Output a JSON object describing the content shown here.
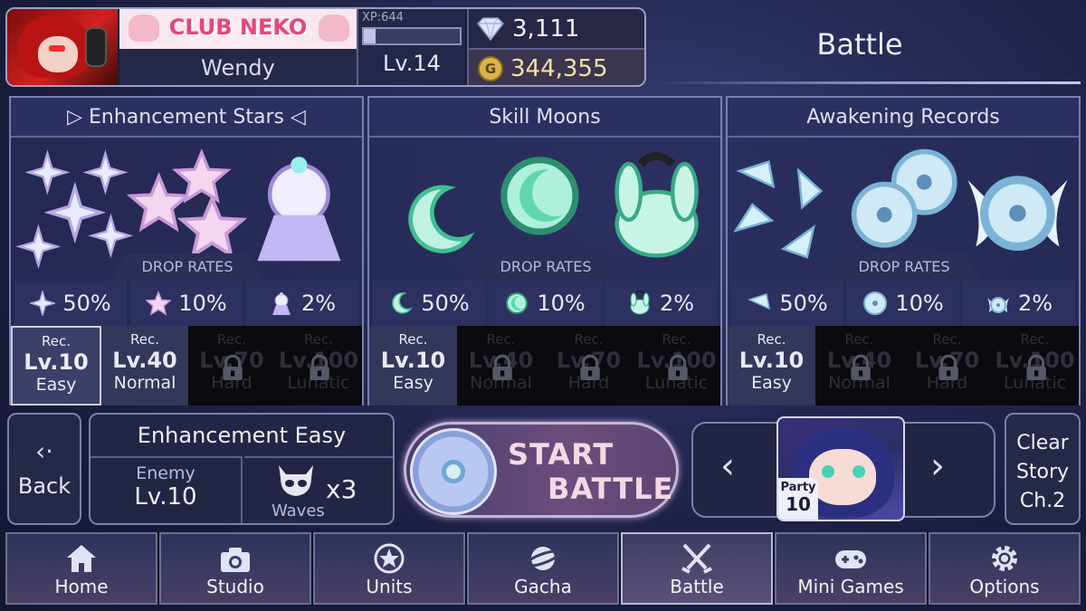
{
  "header": {
    "club_name": "CLUB NEKO",
    "username": "Wendy",
    "xp_label": "XP:644",
    "xp_fraction": 0.12,
    "level": "Lv.14",
    "gems": "3,111",
    "gold_icon": "G",
    "gold": "344,355",
    "screen_title": "Battle"
  },
  "panels": [
    {
      "title": "▷ Enhancement Stars ◁",
      "drop_label": "DROP RATES",
      "rates": [
        "50%",
        "10%",
        "2%"
      ],
      "difficulties": [
        {
          "rec": "Rec.",
          "level": "Lv.10",
          "name": "Easy",
          "state": "selected"
        },
        {
          "rec": "Rec.",
          "level": "Lv.40",
          "name": "Normal",
          "state": "open"
        },
        {
          "rec": "Rec.",
          "level": "Lv.70",
          "name": "Hard",
          "state": "locked"
        },
        {
          "rec": "Rec.",
          "level": "Lv.100",
          "name": "Lunatic",
          "state": "locked"
        }
      ]
    },
    {
      "title": "Skill Moons",
      "drop_label": "DROP RATES",
      "rates": [
        "50%",
        "10%",
        "2%"
      ],
      "difficulties": [
        {
          "rec": "Rec.",
          "level": "Lv.10",
          "name": "Easy",
          "state": "open"
        },
        {
          "rec": "Rec.",
          "level": "Lv.40",
          "name": "Normal",
          "state": "locked"
        },
        {
          "rec": "Rec.",
          "level": "Lv.70",
          "name": "Hard",
          "state": "locked"
        },
        {
          "rec": "Rec.",
          "level": "Lv.100",
          "name": "Lunatic",
          "state": "locked"
        }
      ]
    },
    {
      "title": "Awakening Records",
      "drop_label": "DROP RATES",
      "rates": [
        "50%",
        "10%",
        "2%"
      ],
      "difficulties": [
        {
          "rec": "Rec.",
          "level": "Lv.10",
          "name": "Easy",
          "state": "open"
        },
        {
          "rec": "Rec.",
          "level": "Lv.40",
          "name": "Normal",
          "state": "locked"
        },
        {
          "rec": "Rec.",
          "level": "Lv.70",
          "name": "Hard",
          "state": "locked"
        },
        {
          "rec": "Rec.",
          "level": "Lv.100",
          "name": "Lunatic",
          "state": "locked"
        }
      ]
    }
  ],
  "controls": {
    "back_label": "Back",
    "back_icon": "chevron-left-icon",
    "stage_title": "Enhancement Easy",
    "enemy_label": "Enemy",
    "enemy_level": "Lv.10",
    "waves_label": "Waves",
    "waves_count": "x3",
    "start_line1": "START",
    "start_line2": "BATTLE",
    "party_label": "Party",
    "party_number": "10",
    "clear_story": "Clear Story Ch.2"
  },
  "nav": [
    {
      "label": "Home",
      "icon": "home-icon"
    },
    {
      "label": "Studio",
      "icon": "camera-icon"
    },
    {
      "label": "Units",
      "icon": "star-circle-icon"
    },
    {
      "label": "Gacha",
      "icon": "planet-icon"
    },
    {
      "label": "Battle",
      "icon": "crossed-swords-icon",
      "selected": true
    },
    {
      "label": "Mini Games",
      "icon": "gamepad-icon"
    },
    {
      "label": "Options",
      "icon": "gear-icon"
    }
  ],
  "colors": {
    "accent": "#c8b6d6",
    "panel": "#2c3060",
    "gold": "#d9b54a"
  }
}
